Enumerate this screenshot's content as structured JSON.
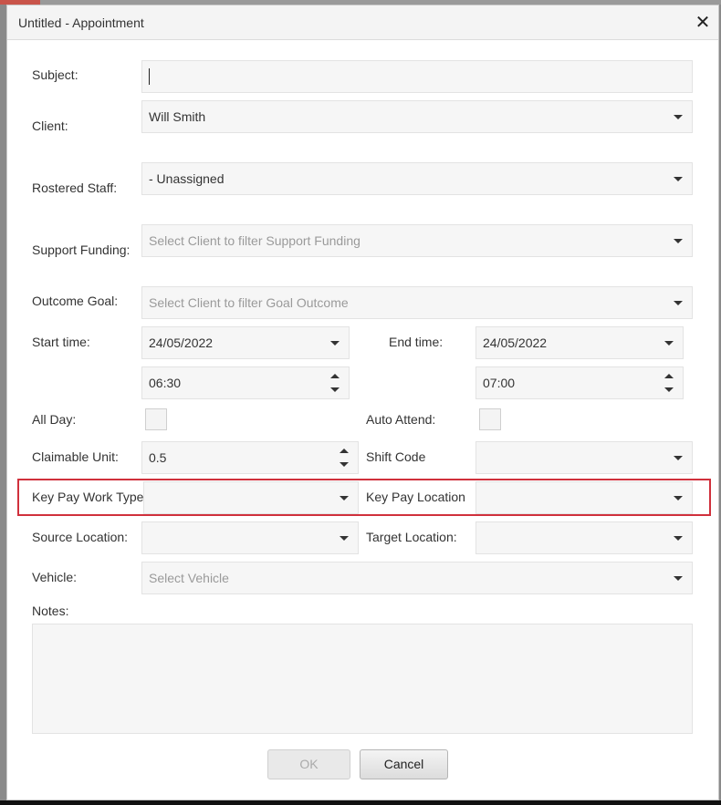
{
  "dialog": {
    "title": "Untitled - Appointment",
    "close_glyph": "✕"
  },
  "form": {
    "subject": {
      "label": "Subject:",
      "value": ""
    },
    "client": {
      "label": "Client:",
      "value": "Will Smith"
    },
    "rostered_staff": {
      "label": "Rostered Staff:",
      "value": "- Unassigned"
    },
    "support_funding": {
      "label": "Support Funding:",
      "placeholder": "Select Client to filter Support Funding"
    },
    "outcome_goal": {
      "label": "Outcome Goal:",
      "placeholder": "Select Client to filter Goal Outcome"
    },
    "start_time": {
      "label": "Start time:",
      "date": "24/05/2022",
      "time": "06:30"
    },
    "end_time": {
      "label": "End time:",
      "date": "24/05/2022",
      "time": "07:00"
    },
    "all_day": {
      "label": "All Day:",
      "checked": false
    },
    "auto_attend": {
      "label": "Auto Attend:",
      "checked": false
    },
    "claimable_unit": {
      "label": "Claimable Unit:",
      "value": "0.5"
    },
    "shift_code": {
      "label": "Shift Code",
      "value": ""
    },
    "key_pay_work_types": {
      "label": "Key Pay Work Types",
      "value": ""
    },
    "key_pay_location": {
      "label": "Key Pay Location",
      "value": ""
    },
    "source_location": {
      "label": "Source Location:",
      "value": ""
    },
    "target_location": {
      "label": "Target Location:",
      "value": ""
    },
    "vehicle": {
      "label": "Vehicle:",
      "placeholder": "Select Vehicle"
    },
    "notes": {
      "label": "Notes:",
      "value": ""
    }
  },
  "buttons": {
    "ok": "OK",
    "cancel": "Cancel"
  },
  "colors": {
    "highlight": "#d0303c"
  }
}
